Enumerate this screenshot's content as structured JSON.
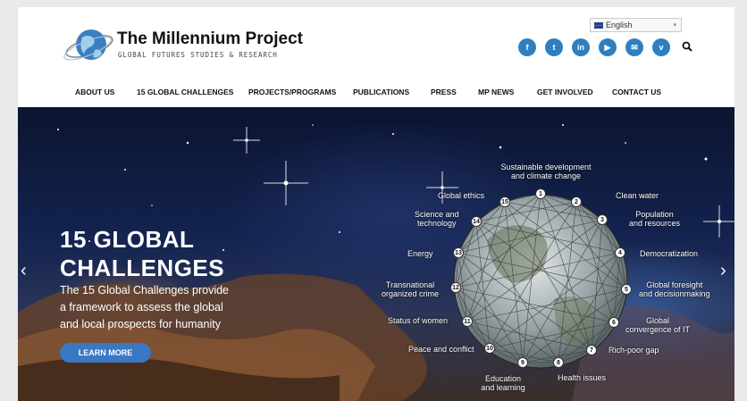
{
  "language_selector": {
    "value": "English"
  },
  "site": {
    "title": "The Millennium Project",
    "tagline": "GLOBAL FUTURES STUDIES & RESEARCH"
  },
  "social": [
    {
      "name": "facebook-icon",
      "glyph": "f"
    },
    {
      "name": "twitter-icon",
      "glyph": "t"
    },
    {
      "name": "linkedin-icon",
      "glyph": "in"
    },
    {
      "name": "youtube-icon",
      "glyph": "▶"
    },
    {
      "name": "email-icon",
      "glyph": "✉"
    },
    {
      "name": "vimeo-icon",
      "glyph": "v"
    }
  ],
  "nav": [
    "ABOUT US",
    "15 GLOBAL CHALLENGES",
    "PROJECTS/PROGRAMS",
    "PUBLICATIONS",
    "PRESS",
    "MP NEWS",
    "GET INVOLVED",
    "CONTACT US"
  ],
  "hero": {
    "title_line1": "15 GLOBAL",
    "title_line2": "CHALLENGES",
    "sub_line1": "The 15 Global Challenges provide",
    "sub_line2": "a framework to assess the global",
    "sub_line3": "and local prospects for humanity",
    "button": "LEARN MORE",
    "prev": "‹",
    "next": "›"
  },
  "challenges": [
    {
      "n": "1",
      "l1": "Sustainable development",
      "l2": "and climate change"
    },
    {
      "n": "2",
      "l1": "Clean water",
      "l2": ""
    },
    {
      "n": "3",
      "l1": "Population",
      "l2": "and resources"
    },
    {
      "n": "4",
      "l1": "Democratization",
      "l2": ""
    },
    {
      "n": "5",
      "l1": "Global foresight",
      "l2": "and decisionmaking"
    },
    {
      "n": "6",
      "l1": "Global",
      "l2": "convergence of IT"
    },
    {
      "n": "7",
      "l1": "Rich-poor gap",
      "l2": ""
    },
    {
      "n": "8",
      "l1": "Health issues",
      "l2": ""
    },
    {
      "n": "9",
      "l1": "Education",
      "l2": "and learning"
    },
    {
      "n": "10",
      "l1": "Peace and conflict",
      "l2": ""
    },
    {
      "n": "11",
      "l1": "Status of women",
      "l2": ""
    },
    {
      "n": "12",
      "l1": "Transnational",
      "l2": "organized crime"
    },
    {
      "n": "13",
      "l1": "Energy",
      "l2": ""
    },
    {
      "n": "14",
      "l1": "Science and",
      "l2": "technology"
    },
    {
      "n": "15",
      "l1": "Global ethics",
      "l2": ""
    }
  ],
  "colors": {
    "accent": "#2f7fc0",
    "button": "#3a78c4"
  }
}
